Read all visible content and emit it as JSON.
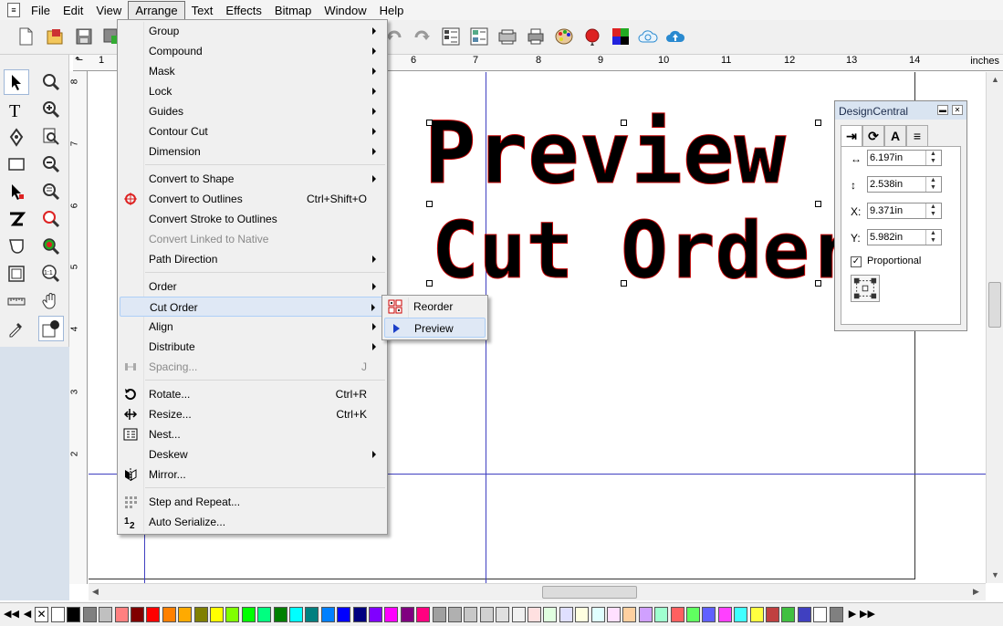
{
  "menubar": {
    "items": [
      "File",
      "Edit",
      "View",
      "Arrange",
      "Text",
      "Effects",
      "Bitmap",
      "Window",
      "Help"
    ],
    "active": "Arrange"
  },
  "ruler": {
    "h_numbers": [
      "1",
      "6",
      "7",
      "8",
      "9",
      "10",
      "11",
      "12",
      "13",
      "14"
    ],
    "units": "inches",
    "v_numbers": [
      "8",
      "7",
      "6",
      "5",
      "4",
      "3",
      "2"
    ]
  },
  "canvas": {
    "line1": "Preview",
    "line2": "Cut Order"
  },
  "arrange_menu": {
    "items": [
      {
        "label": "Group",
        "submenu": true
      },
      {
        "label": "Compound",
        "submenu": true
      },
      {
        "label": "Mask",
        "submenu": true
      },
      {
        "label": "Lock",
        "submenu": true
      },
      {
        "label": "Guides",
        "submenu": true
      },
      {
        "label": "Contour Cut",
        "submenu": true
      },
      {
        "label": "Dimension",
        "submenu": true
      },
      {
        "label": "Convert to Shape",
        "submenu": true
      },
      {
        "label": "Convert to Outlines",
        "shortcut": "Ctrl+Shift+O",
        "icon": "outline-target-icon"
      },
      {
        "label": "Convert Stroke to Outlines"
      },
      {
        "label": "Convert Linked to Native",
        "disabled": true
      },
      {
        "label": "Path Direction",
        "submenu": true
      },
      {
        "label": "Order",
        "submenu": true
      },
      {
        "label": "Cut Order",
        "submenu": true,
        "highlighted": true
      },
      {
        "label": "Align",
        "submenu": true
      },
      {
        "label": "Distribute",
        "submenu": true
      },
      {
        "label": "Spacing...",
        "shortcut": "J",
        "disabled": true,
        "icon": "spacing-icon"
      },
      {
        "label": "Rotate...",
        "shortcut": "Ctrl+R",
        "icon": "rotate-icon"
      },
      {
        "label": "Resize...",
        "shortcut": "Ctrl+K",
        "icon": "resize-icon"
      },
      {
        "label": "Nest...",
        "icon": "nest-icon"
      },
      {
        "label": "Deskew",
        "submenu": true
      },
      {
        "label": "Mirror...",
        "icon": "mirror-icon"
      },
      {
        "label": "Step and Repeat...",
        "icon": "step-repeat-icon"
      },
      {
        "label": "Auto Serialize...",
        "icon": "serialize-icon"
      }
    ]
  },
  "cut_order_submenu": {
    "items": [
      {
        "label": "Reorder",
        "icon": "reorder-icon"
      },
      {
        "label": "Preview",
        "icon": "play-icon",
        "highlighted": true
      }
    ]
  },
  "design_central": {
    "title": "DesignCentral",
    "tabs": [
      "A"
    ],
    "width": "6.197in",
    "height": "2.538in",
    "x_label": "X:",
    "x": "9.371in",
    "y_label": "Y:",
    "y": "5.982in",
    "proportional_label": "Proportional",
    "proportional": true
  },
  "palette": {
    "colors": [
      "#ffffff",
      "#000000",
      "#808080",
      "#c0c0c0",
      "#ff8080",
      "#800000",
      "#ff0000",
      "#ff8000",
      "#ffaa00",
      "#808000",
      "#ffff00",
      "#80ff00",
      "#00ff00",
      "#00ff80",
      "#008000",
      "#00ffff",
      "#008080",
      "#0080ff",
      "#0000ff",
      "#000080",
      "#8000ff",
      "#ff00ff",
      "#800080",
      "#ff0080",
      "#a0a0a0"
    ]
  }
}
